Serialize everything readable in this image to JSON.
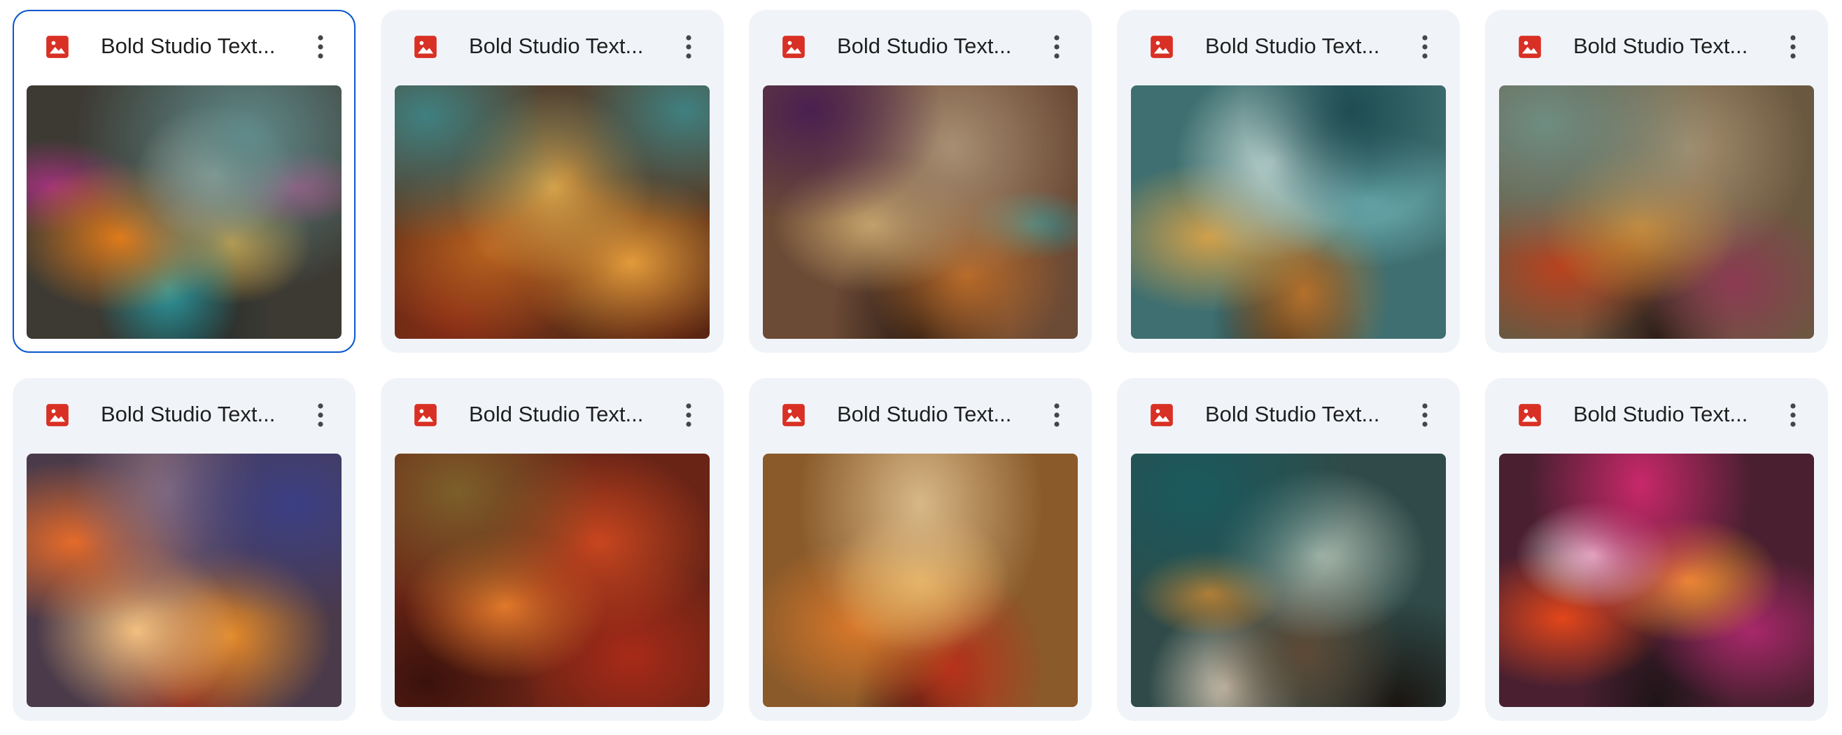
{
  "files": [
    {
      "name": "Bold Studio Text...",
      "icon": "image-file-icon",
      "selected": true,
      "thumb": {
        "base": "#3d3a33",
        "layers": [
          [
            "#5f8a8a",
            70,
            20,
            55
          ],
          [
            "#c7b7a3",
            60,
            35,
            30
          ],
          [
            "#e07a1a",
            30,
            60,
            35
          ],
          [
            "#a0327a",
            8,
            40,
            22
          ],
          [
            "#c2327d",
            85,
            40,
            18
          ],
          [
            "#2f9aa0",
            45,
            80,
            30
          ],
          [
            "#d8a23a",
            65,
            62,
            28
          ],
          [
            "#1e2a2a",
            50,
            95,
            40
          ]
        ]
      }
    },
    {
      "name": "Bold Studio Text...",
      "icon": "image-file-icon",
      "selected": false,
      "thumb": {
        "base": "#5a2f17",
        "layers": [
          [
            "#3f8080",
            10,
            12,
            40
          ],
          [
            "#3f8080",
            92,
            10,
            35
          ],
          [
            "#d7a34a",
            50,
            40,
            45
          ],
          [
            "#b8621f",
            30,
            65,
            40
          ],
          [
            "#8a2a16",
            20,
            90,
            35
          ],
          [
            "#e29a3a",
            75,
            70,
            35
          ],
          [
            "#5a2010",
            85,
            95,
            30
          ]
        ]
      }
    },
    {
      "name": "Bold Studio Text...",
      "icon": "image-file-icon",
      "selected": false,
      "thumb": {
        "base": "#6b4a36",
        "layers": [
          [
            "#4a2050",
            15,
            10,
            35
          ],
          [
            "#a88f72",
            60,
            25,
            50
          ],
          [
            "#c8a46a",
            35,
            55,
            35
          ],
          [
            "#b86a28",
            65,
            75,
            35
          ],
          [
            "#3b8a8a",
            85,
            55,
            18
          ],
          [
            "#2a1a12",
            50,
            98,
            40
          ]
        ]
      }
    },
    {
      "name": "Bold Studio Text...",
      "icon": "image-file-icon",
      "selected": false,
      "thumb": {
        "base": "#3f6f70",
        "layers": [
          [
            "#1e4c52",
            70,
            10,
            35
          ],
          [
            "#bcd3cf",
            45,
            30,
            40
          ],
          [
            "#6fb3b6",
            75,
            45,
            35
          ],
          [
            "#d1a04a",
            25,
            60,
            35
          ],
          [
            "#b4702b",
            55,
            82,
            35
          ],
          [
            "#2b1e14",
            50,
            100,
            35
          ]
        ]
      }
    },
    {
      "name": "Bold Studio Text...",
      "icon": "image-file-icon",
      "selected": false,
      "thumb": {
        "base": "#6b5840",
        "layers": [
          [
            "#6e8d82",
            15,
            15,
            45
          ],
          [
            "#a58f6e",
            60,
            25,
            45
          ],
          [
            "#d28a2e",
            45,
            55,
            40
          ],
          [
            "#b8421f",
            20,
            72,
            30
          ],
          [
            "#8c3a52",
            75,
            78,
            30
          ],
          [
            "#2e1e18",
            50,
            100,
            35
          ]
        ]
      }
    },
    {
      "name": "Bold Studio Text...",
      "icon": "image-file-icon",
      "selected": false,
      "thumb": {
        "base": "#4a3a4a",
        "layers": [
          [
            "#3b3f85",
            85,
            20,
            40
          ],
          [
            "#8a6f80",
            45,
            15,
            40
          ],
          [
            "#e46a2a",
            15,
            35,
            35
          ],
          [
            "#f2c080",
            35,
            70,
            35
          ],
          [
            "#e38a2a",
            65,
            72,
            35
          ],
          [
            "#8a2a20",
            50,
            98,
            40
          ]
        ]
      }
    },
    {
      "name": "Bold Studio Text...",
      "icon": "image-file-icon",
      "selected": false,
      "thumb": {
        "base": "#6a2416",
        "layers": [
          [
            "#7c5f2a",
            20,
            15,
            40
          ],
          [
            "#c8461f",
            65,
            35,
            40
          ],
          [
            "#e0782a",
            35,
            60,
            35
          ],
          [
            "#a82a18",
            75,
            80,
            35
          ],
          [
            "#3a120c",
            10,
            90,
            30
          ]
        ]
      }
    },
    {
      "name": "Bold Studio Text...",
      "icon": "image-file-icon",
      "selected": false,
      "thumb": {
        "base": "#8a5a2a",
        "layers": [
          [
            "#d8b888",
            50,
            20,
            55
          ],
          [
            "#f2b04a",
            50,
            50,
            40
          ],
          [
            "#d9782a",
            30,
            68,
            35
          ],
          [
            "#b8321a",
            60,
            85,
            35
          ],
          [
            "#2a1410",
            50,
            100,
            30
          ]
        ]
      }
    },
    {
      "name": "Bold Studio Text...",
      "icon": "image-file-icon",
      "selected": false,
      "thumb": {
        "base": "#2f4a48",
        "layers": [
          [
            "#1a5a5e",
            20,
            15,
            45
          ],
          [
            "#a8b8ac",
            60,
            40,
            40
          ],
          [
            "#e08a2a",
            25,
            55,
            22
          ],
          [
            "#5e4a36",
            55,
            78,
            40
          ],
          [
            "#c8bcaa",
            30,
            92,
            25
          ],
          [
            "#1a1410",
            85,
            100,
            30
          ]
        ]
      }
    },
    {
      "name": "Bold Studio Text...",
      "icon": "image-file-icon",
      "selected": false,
      "thumb": {
        "base": "#4a2030",
        "layers": [
          [
            "#c8286a",
            45,
            12,
            45
          ],
          [
            "#f0e0e8",
            30,
            40,
            25
          ],
          [
            "#f39a2a",
            60,
            50,
            35
          ],
          [
            "#e2461a",
            20,
            65,
            30
          ],
          [
            "#a8286a",
            80,
            70,
            30
          ],
          [
            "#1e1418",
            50,
            100,
            35
          ]
        ]
      }
    }
  ]
}
